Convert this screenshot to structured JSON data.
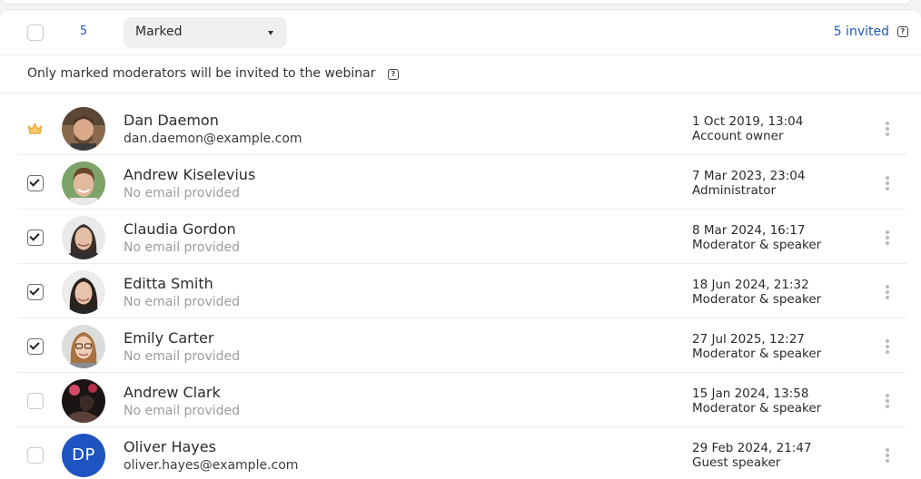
{
  "toolbar": {
    "selected_count": "5",
    "filter_value": "Marked",
    "invited_label": "5 invited"
  },
  "notice": "Only marked moderators will be invited to the webinar",
  "colors": {
    "accent": "#1f5bbd",
    "avatar_initials_bg": "#1e54c2",
    "crown": "#f2b53b"
  },
  "moderators": [
    {
      "name": "Dan Daemon",
      "email": "dan.daemon@example.com",
      "date": "1 Oct 2019, 13:04",
      "role": "Account owner"
    },
    {
      "name": "Andrew Kiselevius",
      "email": "No email provided",
      "date": "7 Mar 2023, 23:04",
      "role": "Administrator"
    },
    {
      "name": "Claudia Gordon",
      "email": "No email provided",
      "date": "8 Mar 2024, 16:17",
      "role": "Moderator & speaker"
    },
    {
      "name": "Editta Smith",
      "email": "No email provided",
      "date": "18 Jun 2024, 21:32",
      "role": "Moderator & speaker"
    },
    {
      "name": "Emily Carter",
      "email": "No email provided",
      "date": "27 Jul 2025, 12:27",
      "role": "Moderator & speaker"
    },
    {
      "name": "Andrew Clark",
      "email": "No email provided",
      "date": "15 Jan 2024, 13:58",
      "role": "Moderator & speaker"
    },
    {
      "name": "Oliver Hayes",
      "email": "oliver.hayes@example.com",
      "date": "29 Feb 2024, 21:47",
      "role": "Guest speaker",
      "initials": "DP"
    }
  ]
}
